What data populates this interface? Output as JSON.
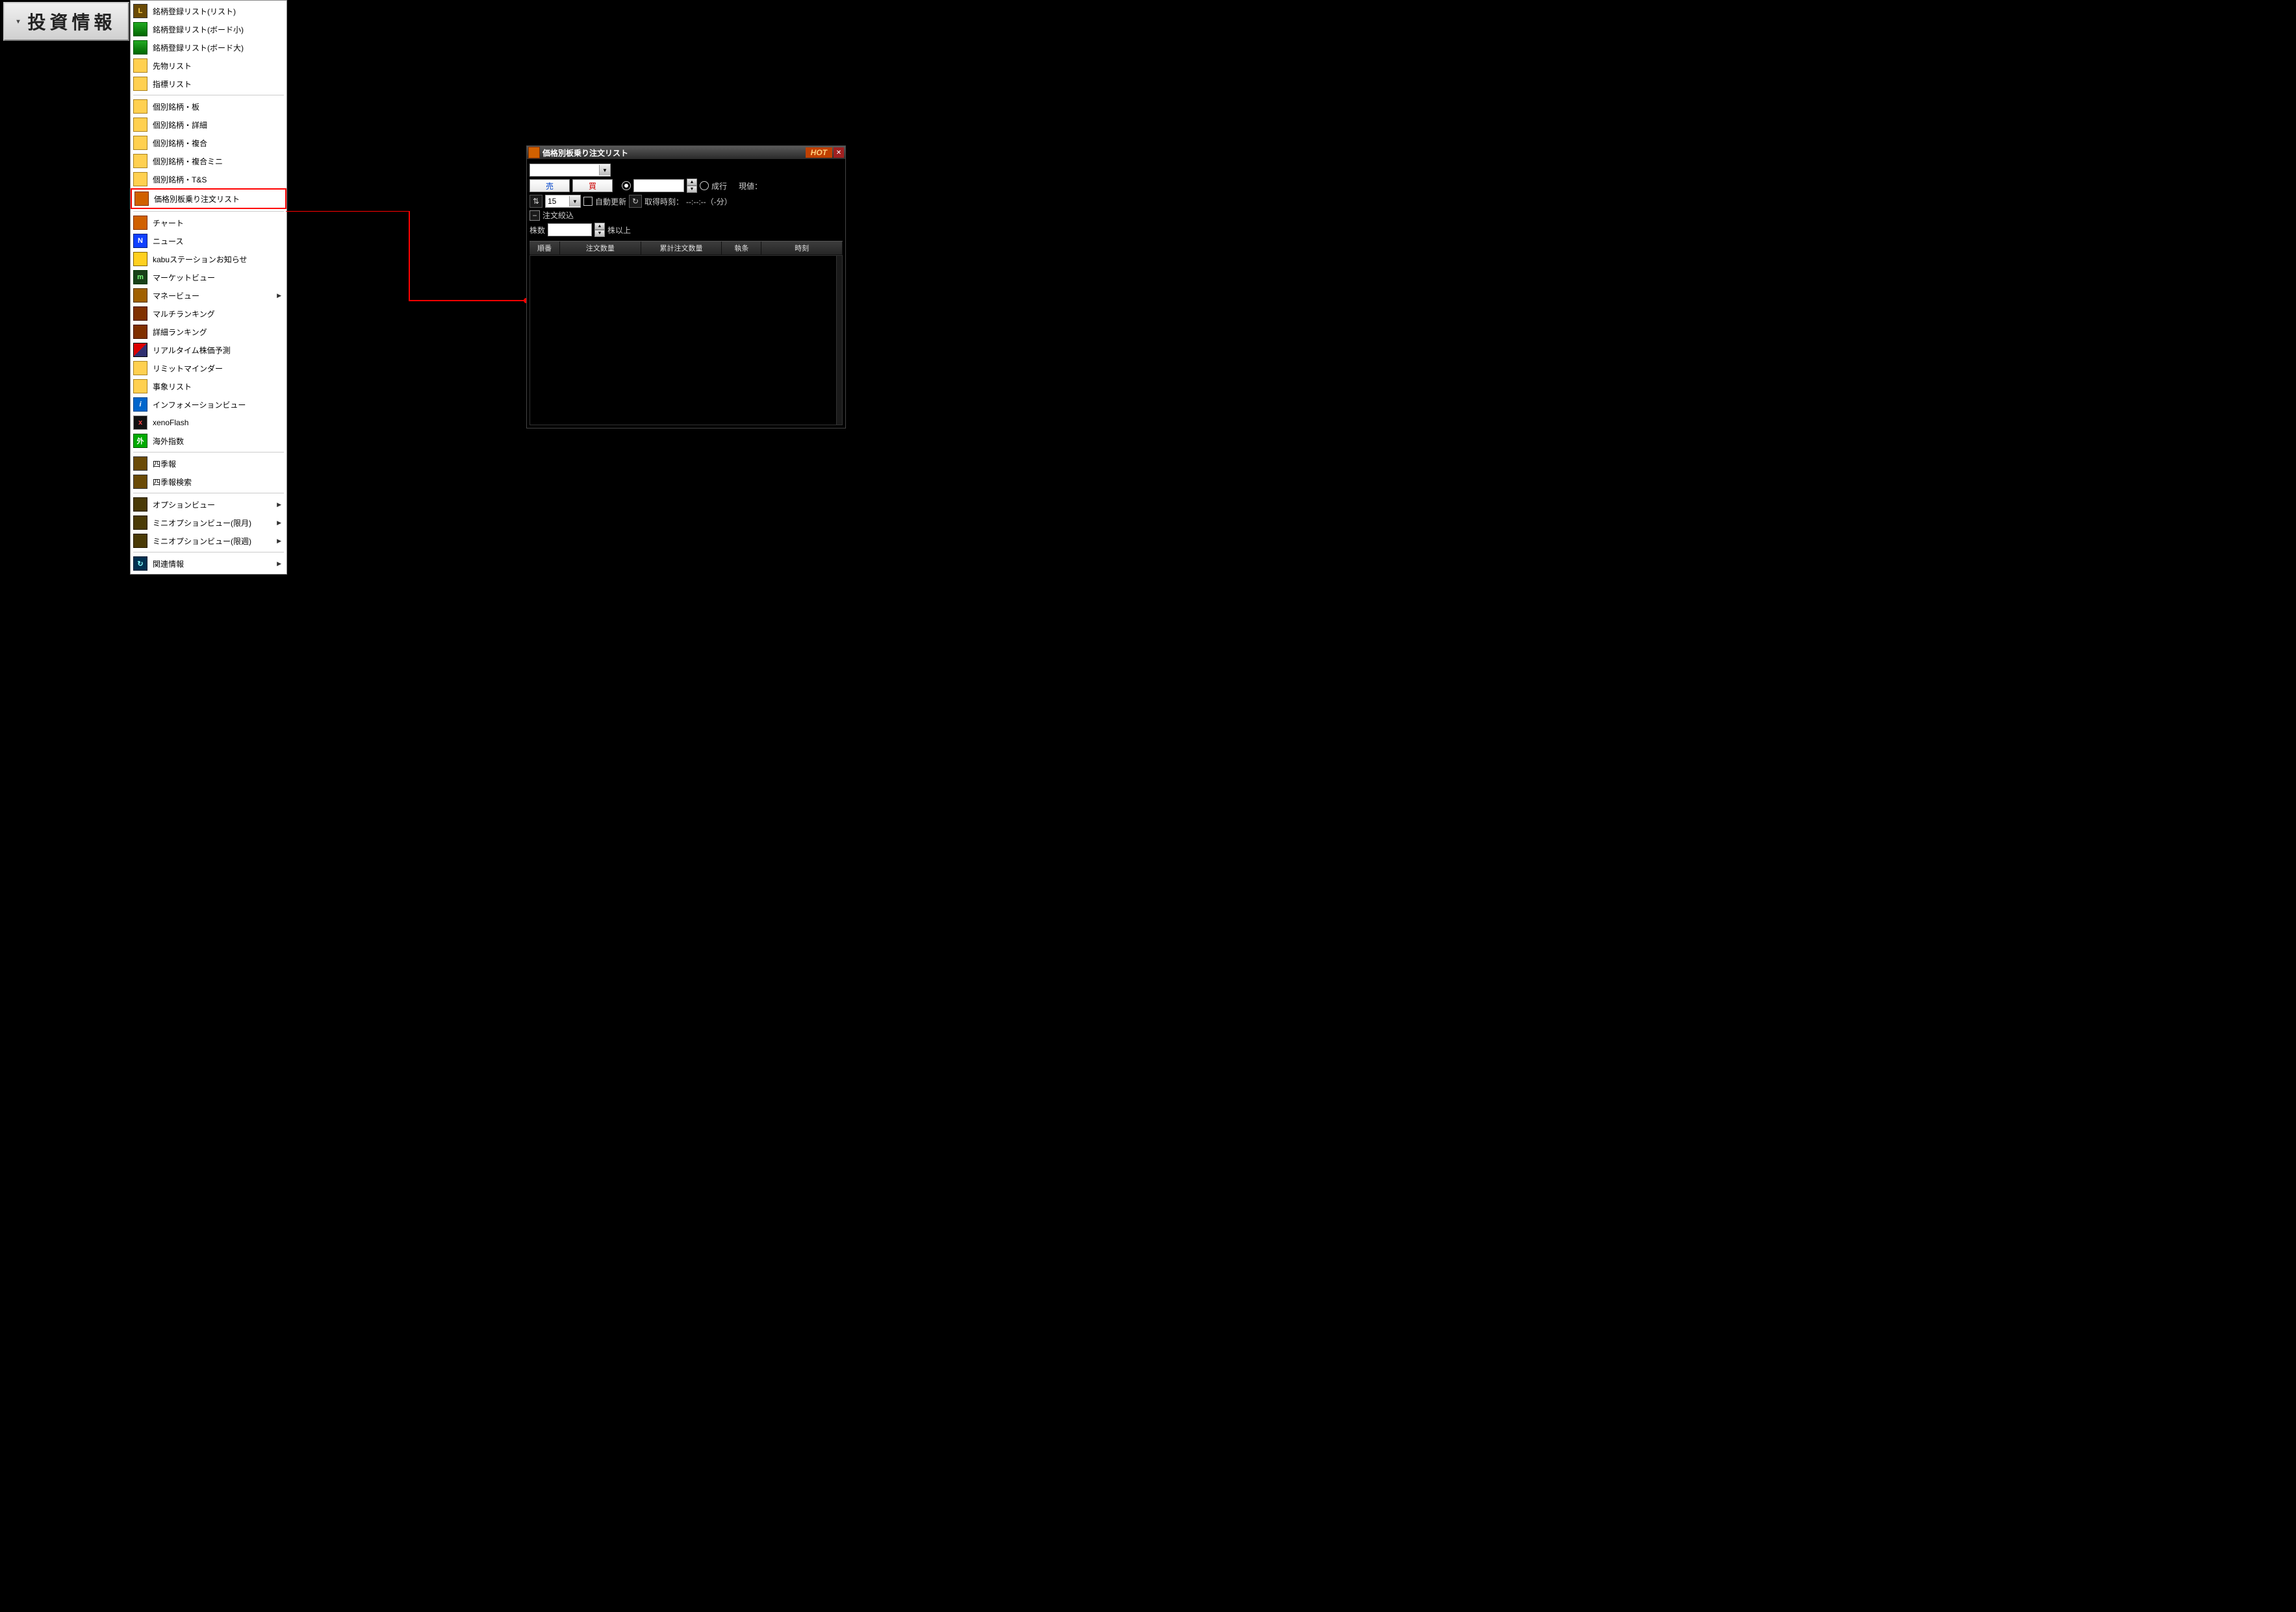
{
  "main_button": "投資情報",
  "menu": {
    "items": [
      {
        "label": "銘柄登録リスト(リスト)",
        "icon": "ic-L",
        "glyph": "L"
      },
      {
        "label": "銘柄登録リスト(ボード小)",
        "icon": "ic-grid",
        "glyph": ""
      },
      {
        "label": "銘柄登録リスト(ボード大)",
        "icon": "ic-grid",
        "glyph": ""
      },
      {
        "label": "先物リスト",
        "icon": "ic-tbl",
        "glyph": ""
      },
      {
        "label": "指標リスト",
        "icon": "ic-tbl",
        "glyph": ""
      },
      {
        "sep": true
      },
      {
        "label": "個別銘柄・板",
        "icon": "ic-tbl",
        "glyph": ""
      },
      {
        "label": "個別銘柄・詳細",
        "icon": "ic-tbl",
        "glyph": ""
      },
      {
        "label": "個別銘柄・複合",
        "icon": "ic-tbl",
        "glyph": ""
      },
      {
        "label": "個別銘柄・複合ミニ",
        "icon": "ic-tbl",
        "glyph": ""
      },
      {
        "label": "個別銘柄・T&S",
        "icon": "ic-tbl",
        "glyph": ""
      },
      {
        "label": "価格別板乗り注文リスト",
        "icon": "ic-chart",
        "glyph": "",
        "hi": true
      },
      {
        "sep": true
      },
      {
        "label": "チャート",
        "icon": "ic-chart",
        "glyph": ""
      },
      {
        "label": "ニュース",
        "icon": "ic-N",
        "glyph": "N"
      },
      {
        "label": "kabuステーションお知らせ",
        "icon": "ic-mail",
        "glyph": ""
      },
      {
        "label": "マーケットビュー",
        "icon": "ic-m",
        "glyph": "m"
      },
      {
        "label": "マネービュー",
        "icon": "ic-gauge",
        "glyph": "",
        "sub": true
      },
      {
        "label": "マルチランキング",
        "icon": "ic-rank",
        "glyph": ""
      },
      {
        "label": "詳細ランキング",
        "icon": "ic-rank",
        "glyph": ""
      },
      {
        "label": "リアルタイム株価予測",
        "icon": "ic-slash",
        "glyph": ""
      },
      {
        "label": "リミットマインダー",
        "icon": "ic-tbl",
        "glyph": ""
      },
      {
        "label": "事象リスト",
        "icon": "ic-tbl",
        "glyph": ""
      },
      {
        "label": "インフォメーションビュー",
        "icon": "ic-i",
        "glyph": "i"
      },
      {
        "label": "xenoFlash",
        "icon": "ic-x",
        "glyph": "x"
      },
      {
        "label": "海外指数",
        "icon": "ic-fx",
        "glyph": "外"
      },
      {
        "sep": true
      },
      {
        "label": "四季報",
        "icon": "ic-shiki",
        "glyph": ""
      },
      {
        "label": "四季報検索",
        "icon": "ic-shiki",
        "glyph": ""
      },
      {
        "sep": true
      },
      {
        "label": "オプションビュー",
        "icon": "ic-op",
        "glyph": "",
        "sub": true
      },
      {
        "label": "ミニオプションビュー(限月)",
        "icon": "ic-op",
        "glyph": "",
        "sub": true
      },
      {
        "label": "ミニオプションビュー(限週)",
        "icon": "ic-op",
        "glyph": "",
        "sub": true
      },
      {
        "sep": true
      },
      {
        "label": "関連情報",
        "icon": "ic-rel",
        "glyph": "↻",
        "sub": true
      }
    ]
  },
  "window": {
    "title": "価格別板乗り注文リスト",
    "hot": "HOT",
    "symbol_input": "",
    "sell": "売",
    "buy": "買",
    "price_input": "",
    "market_order": "成行",
    "current_price_label": "現値：",
    "current_price_value": "",
    "interval": "15",
    "auto_refresh": "自動更新",
    "fetch_time_label": "取得時刻：",
    "fetch_time_value": "--:--:--（-分）",
    "filter_label": "注文絞込",
    "shares_label": "株数",
    "shares_input": "",
    "shares_suffix": "株以上",
    "columns": [
      "順番",
      "注文数量",
      "累計注文数量",
      "執条",
      "時刻"
    ]
  }
}
